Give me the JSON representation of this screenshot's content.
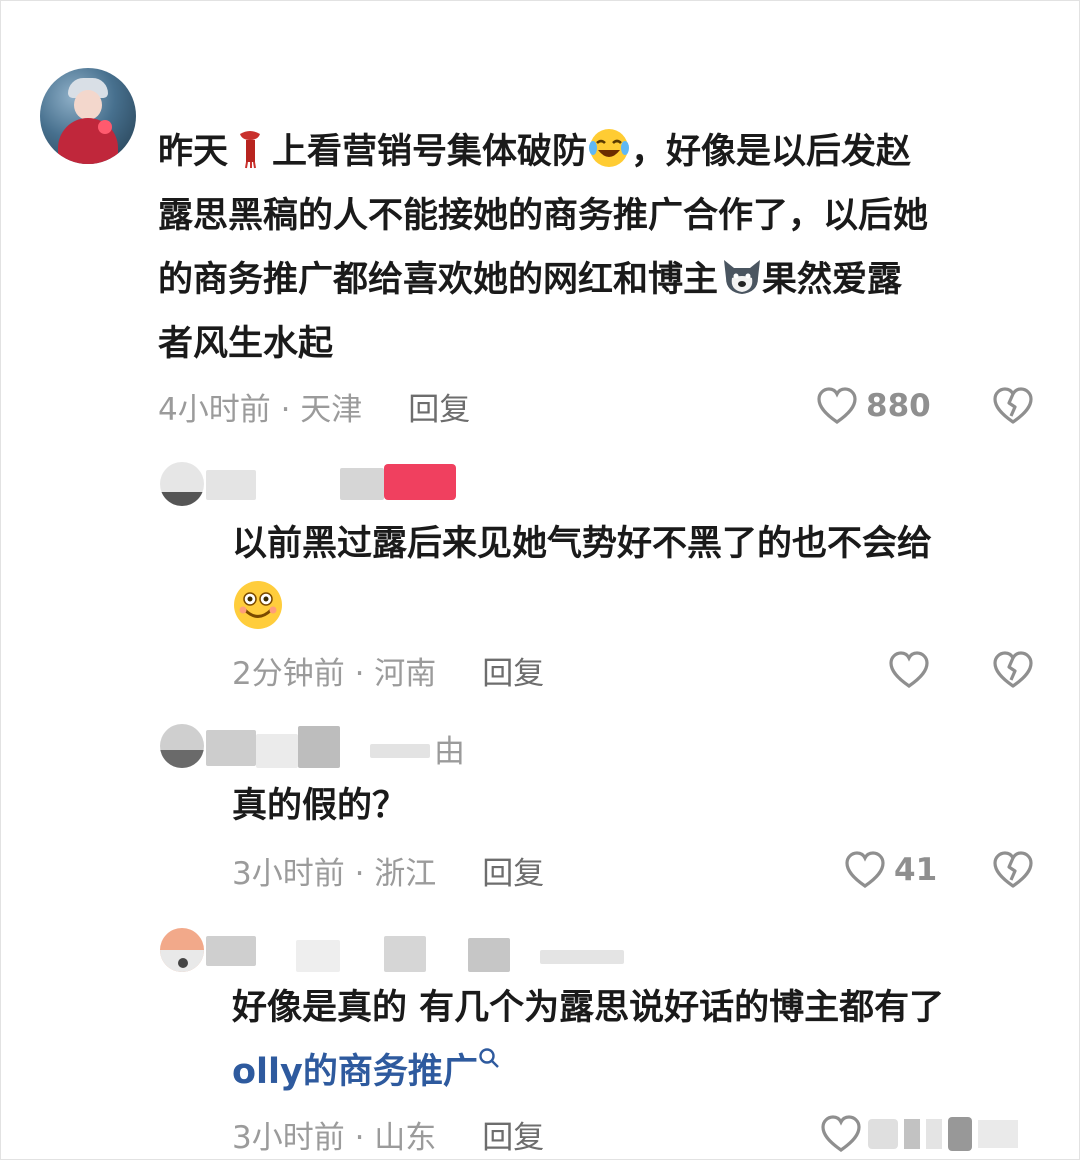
{
  "comments": [
    {
      "text_lines": [
        "昨天",
        "上看营销号集体破防",
        "，好像是以后发赵",
        "露思黑稿的人不能接她的商务推广合作了，以后她",
        "的商务推广都给喜欢她的网红和博主",
        "果然爱露",
        "者风生水起"
      ],
      "time_location": "4小时前 · 天津",
      "reply_label": "回复",
      "likes": "880"
    },
    {
      "username_fragment": "",
      "text_lines": [
        "以前黑过露后来见她气势好不黑了的也不会给"
      ],
      "time_location": "2分钟前 · 河南",
      "reply_label": "回复",
      "likes": ""
    },
    {
      "username_fragment": "由",
      "text_lines": [
        "真的假的？"
      ],
      "time_location": "3小时前 · 浙江",
      "reply_label": "回复",
      "likes": "41"
    },
    {
      "text_lines": [
        "好像是真的 有几个为露思说好话的博主都有了"
      ],
      "link_text": "olly的商务推广",
      "time_location": "3小时前 · 山东",
      "reply_label": "回复",
      "likes": ""
    }
  ],
  "icons": {
    "like": "heart-outline-icon",
    "dislike": "broken-heart-icon",
    "search": "search-icon",
    "scarf": "red-scarf-emoji",
    "laugh": "laughing-crying-emoji",
    "dog": "dog-face-emoji",
    "smile": "smiling-emoji"
  },
  "colors": {
    "text": "#1a1a1a",
    "meta": "#9b9b9b",
    "link": "#2e5a9e",
    "accent_pink": "#f0405f"
  }
}
